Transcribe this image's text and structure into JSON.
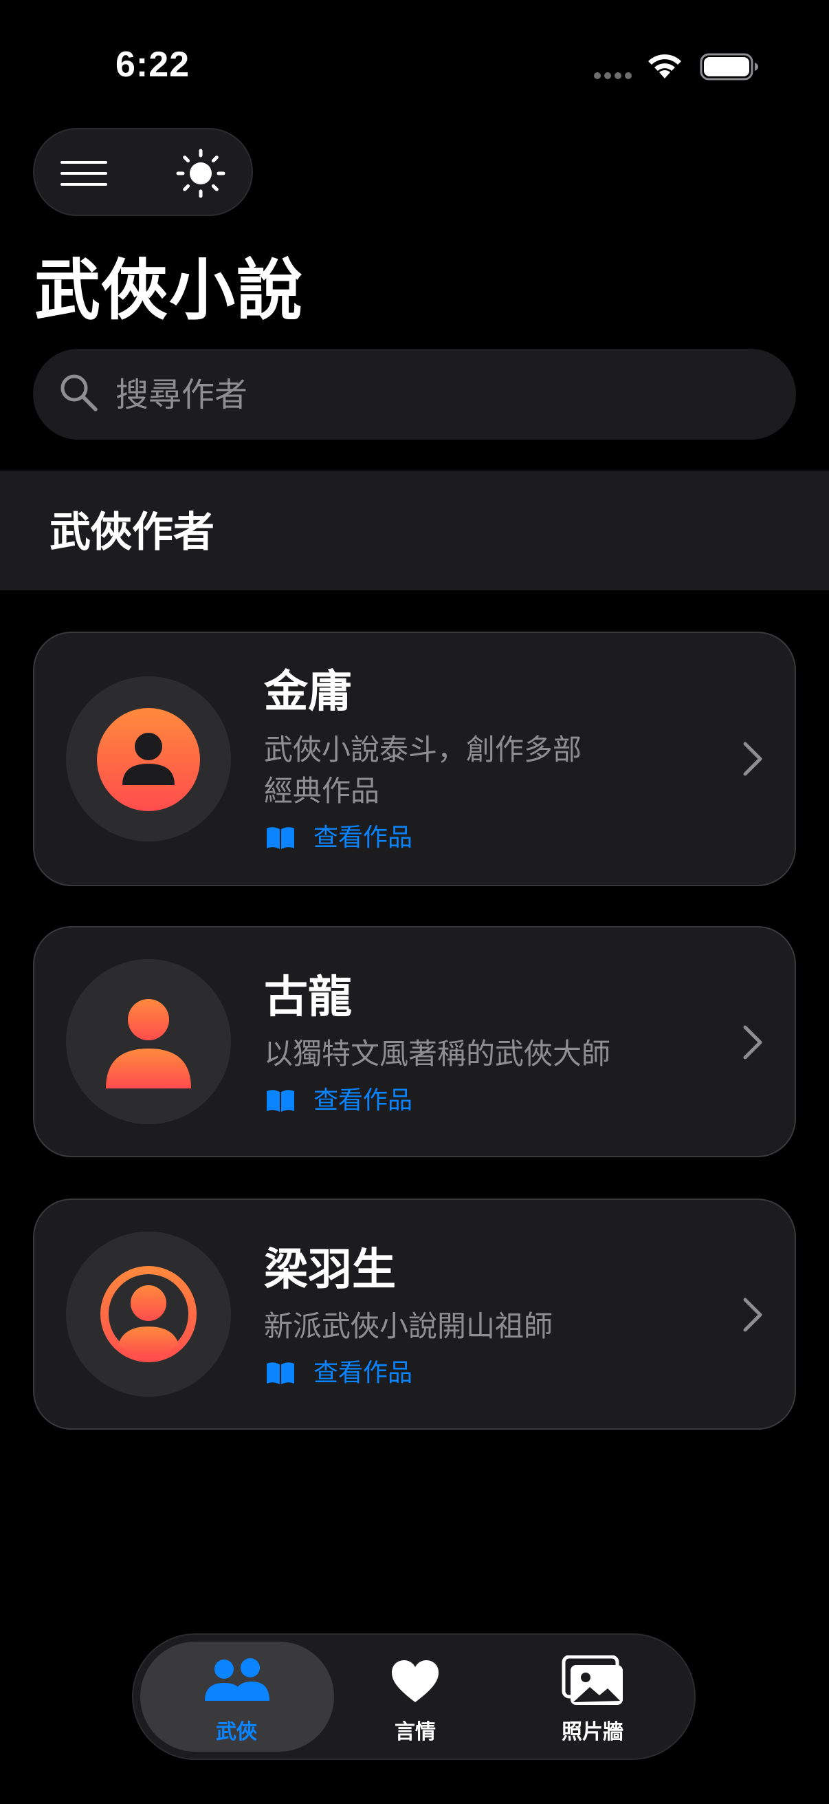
{
  "status_bar": {
    "time": "6:22"
  },
  "page": {
    "title": "武俠小說"
  },
  "search": {
    "placeholder": "搜尋作者",
    "value": ""
  },
  "section": {
    "title": "武俠作者"
  },
  "authors": [
    {
      "name": "金庸",
      "description_lines": [
        "武俠小說泰斗，創作多部",
        "經典作品"
      ],
      "works_label": "查看作品",
      "icon": "person-icon"
    },
    {
      "name": "古龍",
      "description_lines": [
        "以獨特文風著稱的武俠大師"
      ],
      "works_label": "查看作品",
      "icon": "person-icon"
    },
    {
      "name": "梁羽生",
      "description_lines": [
        "新派武俠小說開山祖師"
      ],
      "works_label": "查看作品",
      "icon": "person-icon"
    }
  ],
  "tabs": [
    {
      "label": "武俠",
      "icon": "people-icon",
      "active": true
    },
    {
      "label": "言情",
      "icon": "heart-icon",
      "active": false
    },
    {
      "label": "照片牆",
      "icon": "photos-icon",
      "active": false
    }
  ],
  "colors": {
    "accent": "#0a84ff",
    "avatar_gradient_top": "#ff8a3d",
    "avatar_gradient_bottom": "#ff4d4d",
    "card_bg": "#1c1c1e"
  }
}
